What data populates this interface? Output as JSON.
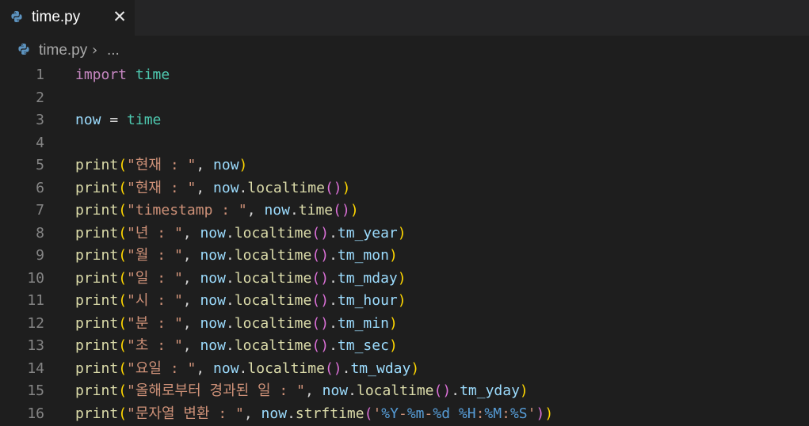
{
  "tab": {
    "label": "time.py",
    "close_glyph": "✕",
    "icon": "python-icon"
  },
  "breadcrumb": {
    "file": "time.py",
    "separator": "›",
    "more": "...",
    "icon": "python-icon"
  },
  "colors": {
    "keyword": "#c586c0",
    "module": "#4ec9b0",
    "variable": "#9cdcfe",
    "function": "#dcdcaa",
    "string": "#ce9178",
    "format_spec": "#569cd6",
    "bracket_level1": "#ffd700",
    "bracket_level2": "#da70d6",
    "background": "#1e1e1e"
  },
  "lines": [
    {
      "num": "1",
      "tokens": [
        [
          "kw",
          "import"
        ],
        [
          "op",
          " "
        ],
        [
          "mod",
          "time"
        ]
      ]
    },
    {
      "num": "2",
      "tokens": []
    },
    {
      "num": "3",
      "tokens": [
        [
          "var",
          "now"
        ],
        [
          "op",
          " = "
        ],
        [
          "mod",
          "time"
        ]
      ]
    },
    {
      "num": "4",
      "tokens": []
    },
    {
      "num": "5",
      "tokens": [
        [
          "fn",
          "print"
        ],
        [
          "b1",
          "("
        ],
        [
          "str",
          "\"현재 : \""
        ],
        [
          "pn",
          ", "
        ],
        [
          "var",
          "now"
        ],
        [
          "b1",
          ")"
        ]
      ]
    },
    {
      "num": "6",
      "tokens": [
        [
          "fn",
          "print"
        ],
        [
          "b1",
          "("
        ],
        [
          "str",
          "\"현재 : \""
        ],
        [
          "pn",
          ", "
        ],
        [
          "var",
          "now"
        ],
        [
          "pn",
          "."
        ],
        [
          "fn",
          "localtime"
        ],
        [
          "b2",
          "()"
        ],
        [
          "b1",
          ")"
        ]
      ]
    },
    {
      "num": "7",
      "tokens": [
        [
          "fn",
          "print"
        ],
        [
          "b1",
          "("
        ],
        [
          "str",
          "\"timestamp : \""
        ],
        [
          "pn",
          ", "
        ],
        [
          "var",
          "now"
        ],
        [
          "pn",
          "."
        ],
        [
          "fn",
          "time"
        ],
        [
          "b2",
          "()"
        ],
        [
          "b1",
          ")"
        ]
      ]
    },
    {
      "num": "8",
      "tokens": [
        [
          "fn",
          "print"
        ],
        [
          "b1",
          "("
        ],
        [
          "str",
          "\"년 : \""
        ],
        [
          "pn",
          ", "
        ],
        [
          "var",
          "now"
        ],
        [
          "pn",
          "."
        ],
        [
          "fn",
          "localtime"
        ],
        [
          "b2",
          "()"
        ],
        [
          "pn",
          "."
        ],
        [
          "var",
          "tm_year"
        ],
        [
          "b1",
          ")"
        ]
      ]
    },
    {
      "num": "9",
      "tokens": [
        [
          "fn",
          "print"
        ],
        [
          "b1",
          "("
        ],
        [
          "str",
          "\"월 : \""
        ],
        [
          "pn",
          ", "
        ],
        [
          "var",
          "now"
        ],
        [
          "pn",
          "."
        ],
        [
          "fn",
          "localtime"
        ],
        [
          "b2",
          "()"
        ],
        [
          "pn",
          "."
        ],
        [
          "var",
          "tm_mon"
        ],
        [
          "b1",
          ")"
        ]
      ]
    },
    {
      "num": "10",
      "tokens": [
        [
          "fn",
          "print"
        ],
        [
          "b1",
          "("
        ],
        [
          "str",
          "\"일 : \""
        ],
        [
          "pn",
          ", "
        ],
        [
          "var",
          "now"
        ],
        [
          "pn",
          "."
        ],
        [
          "fn",
          "localtime"
        ],
        [
          "b2",
          "()"
        ],
        [
          "pn",
          "."
        ],
        [
          "var",
          "tm_mday"
        ],
        [
          "b1",
          ")"
        ]
      ]
    },
    {
      "num": "11",
      "tokens": [
        [
          "fn",
          "print"
        ],
        [
          "b1",
          "("
        ],
        [
          "str",
          "\"시 : \""
        ],
        [
          "pn",
          ", "
        ],
        [
          "var",
          "now"
        ],
        [
          "pn",
          "."
        ],
        [
          "fn",
          "localtime"
        ],
        [
          "b2",
          "()"
        ],
        [
          "pn",
          "."
        ],
        [
          "var",
          "tm_hour"
        ],
        [
          "b1",
          ")"
        ]
      ]
    },
    {
      "num": "12",
      "tokens": [
        [
          "fn",
          "print"
        ],
        [
          "b1",
          "("
        ],
        [
          "str",
          "\"분 : \""
        ],
        [
          "pn",
          ", "
        ],
        [
          "var",
          "now"
        ],
        [
          "pn",
          "."
        ],
        [
          "fn",
          "localtime"
        ],
        [
          "b2",
          "()"
        ],
        [
          "pn",
          "."
        ],
        [
          "var",
          "tm_min"
        ],
        [
          "b1",
          ")"
        ]
      ]
    },
    {
      "num": "13",
      "tokens": [
        [
          "fn",
          "print"
        ],
        [
          "b1",
          "("
        ],
        [
          "str",
          "\"초 : \""
        ],
        [
          "pn",
          ", "
        ],
        [
          "var",
          "now"
        ],
        [
          "pn",
          "."
        ],
        [
          "fn",
          "localtime"
        ],
        [
          "b2",
          "()"
        ],
        [
          "pn",
          "."
        ],
        [
          "var",
          "tm_sec"
        ],
        [
          "b1",
          ")"
        ]
      ]
    },
    {
      "num": "14",
      "tokens": [
        [
          "fn",
          "print"
        ],
        [
          "b1",
          "("
        ],
        [
          "str",
          "\"요일 : \""
        ],
        [
          "pn",
          ", "
        ],
        [
          "var",
          "now"
        ],
        [
          "pn",
          "."
        ],
        [
          "fn",
          "localtime"
        ],
        [
          "b2",
          "()"
        ],
        [
          "pn",
          "."
        ],
        [
          "var",
          "tm_wday"
        ],
        [
          "b1",
          ")"
        ]
      ]
    },
    {
      "num": "15",
      "tokens": [
        [
          "fn",
          "print"
        ],
        [
          "b1",
          "("
        ],
        [
          "str",
          "\"올해로부터 경과된 일 : \""
        ],
        [
          "pn",
          ", "
        ],
        [
          "var",
          "now"
        ],
        [
          "pn",
          "."
        ],
        [
          "fn",
          "localtime"
        ],
        [
          "b2",
          "()"
        ],
        [
          "pn",
          "."
        ],
        [
          "var",
          "tm_yday"
        ],
        [
          "b1",
          ")"
        ]
      ]
    },
    {
      "num": "16",
      "tokens": [
        [
          "fn",
          "print"
        ],
        [
          "b1",
          "("
        ],
        [
          "str",
          "\"문자열 변환 : \""
        ],
        [
          "pn",
          ", "
        ],
        [
          "var",
          "now"
        ],
        [
          "pn",
          "."
        ],
        [
          "fn",
          "strftime"
        ],
        [
          "b2",
          "("
        ],
        [
          "str",
          "'"
        ],
        [
          "fmt",
          "%Y"
        ],
        [
          "str",
          "-"
        ],
        [
          "fmt",
          "%m"
        ],
        [
          "str",
          "-"
        ],
        [
          "fmt",
          "%d"
        ],
        [
          "str",
          " "
        ],
        [
          "fmt",
          "%H"
        ],
        [
          "str",
          ":"
        ],
        [
          "fmt",
          "%M"
        ],
        [
          "str",
          ":"
        ],
        [
          "fmt",
          "%S"
        ],
        [
          "str",
          "'"
        ],
        [
          "b2",
          ")"
        ],
        [
          "b1",
          ")"
        ]
      ]
    }
  ]
}
